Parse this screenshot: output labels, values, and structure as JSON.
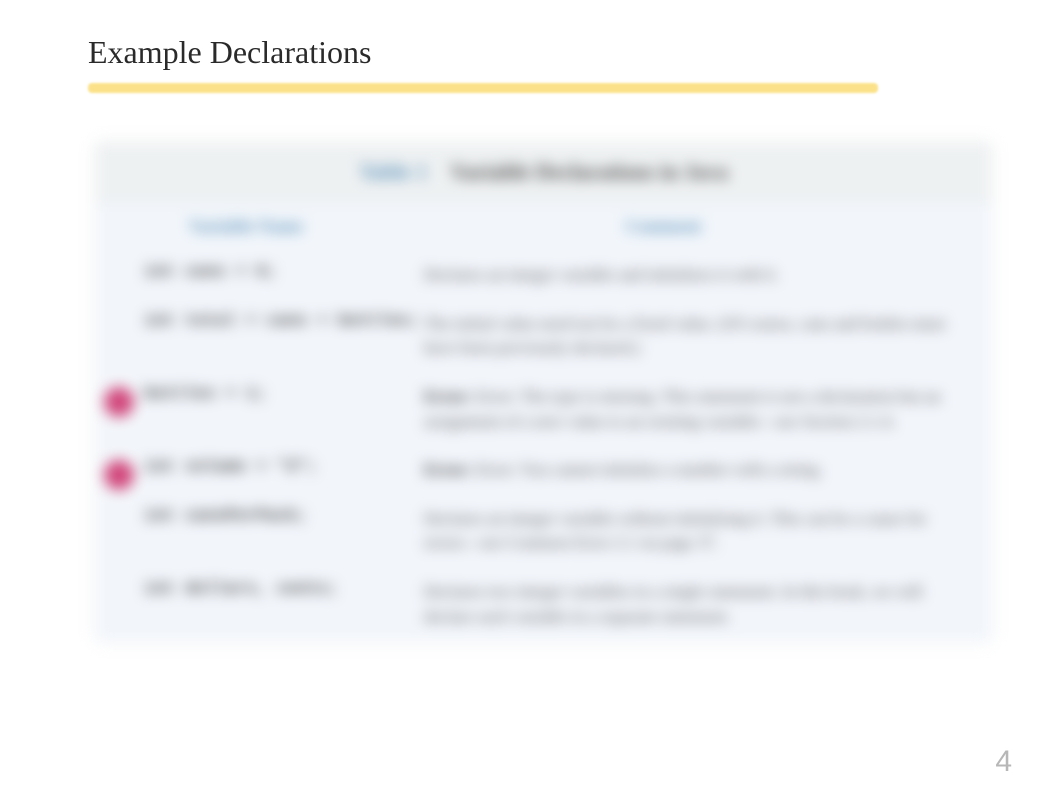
{
  "title": "Example Declarations",
  "table": {
    "caption_label": "Table 1",
    "caption_text": "Variable Declarations in Java",
    "head_col1": "Variable Name",
    "head_col2": "Comment",
    "rows": [
      {
        "error": false,
        "code": "int cans = 6;",
        "comment": "Declares an integer variable and initializes it with 6."
      },
      {
        "error": false,
        "code": "int total = cans + bottles;",
        "comment": "The initial value need not be a fixed value. (Of course, cans and bottles must have been previously declared.)"
      },
      {
        "error": true,
        "code": "bottles = 1;",
        "comment": "Error: The type is missing. This statement is not a declaration but an assignment of a new value to an existing variable—see Section 2.1.4."
      },
      {
        "error": true,
        "code": "int volume = \"2\";",
        "comment": "Error: You cannot initialize a number with a string."
      },
      {
        "error": false,
        "code": "int cansPerPack;",
        "comment": "Declares an integer variable without initializing it. This can be a cause for errors—see Common Error 2.1 on page 37."
      },
      {
        "error": false,
        "code": "int dollars, cents;",
        "comment": "Declares two integer variables in a single statement. In this book, we will declare each variable in a separate statement."
      }
    ]
  },
  "page_number": "4"
}
